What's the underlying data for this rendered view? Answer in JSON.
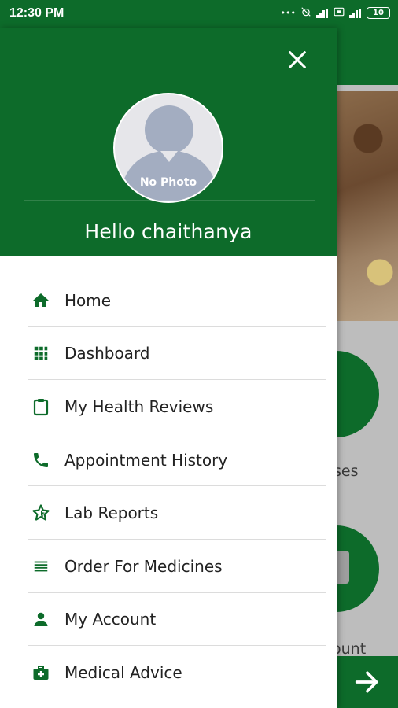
{
  "status_bar": {
    "time": "12:30 PM",
    "battery": "10"
  },
  "colors": {
    "primary_green": "#0d6b2a",
    "icon_green": "#0d6b2a",
    "text_dark": "#222222"
  },
  "drawer": {
    "avatar_caption": "No Photo",
    "greeting": "Hello chaithanya",
    "items": [
      {
        "label": "Home",
        "icon": "home-icon"
      },
      {
        "label": "Dashboard",
        "icon": "grid-icon"
      },
      {
        "label": "My Health Reviews",
        "icon": "clipboard-icon"
      },
      {
        "label": "Appointment History",
        "icon": "phone-icon"
      },
      {
        "label": "Lab Reports",
        "icon": "star-icon"
      },
      {
        "label": "Order For Medicines",
        "icon": "list-icon"
      },
      {
        "label": "My Account",
        "icon": "person-icon"
      },
      {
        "label": "Medical Advice",
        "icon": "medical-kit-icon"
      }
    ]
  },
  "background_app": {
    "partial_label_1": "ses",
    "partial_label_2": "ount"
  }
}
